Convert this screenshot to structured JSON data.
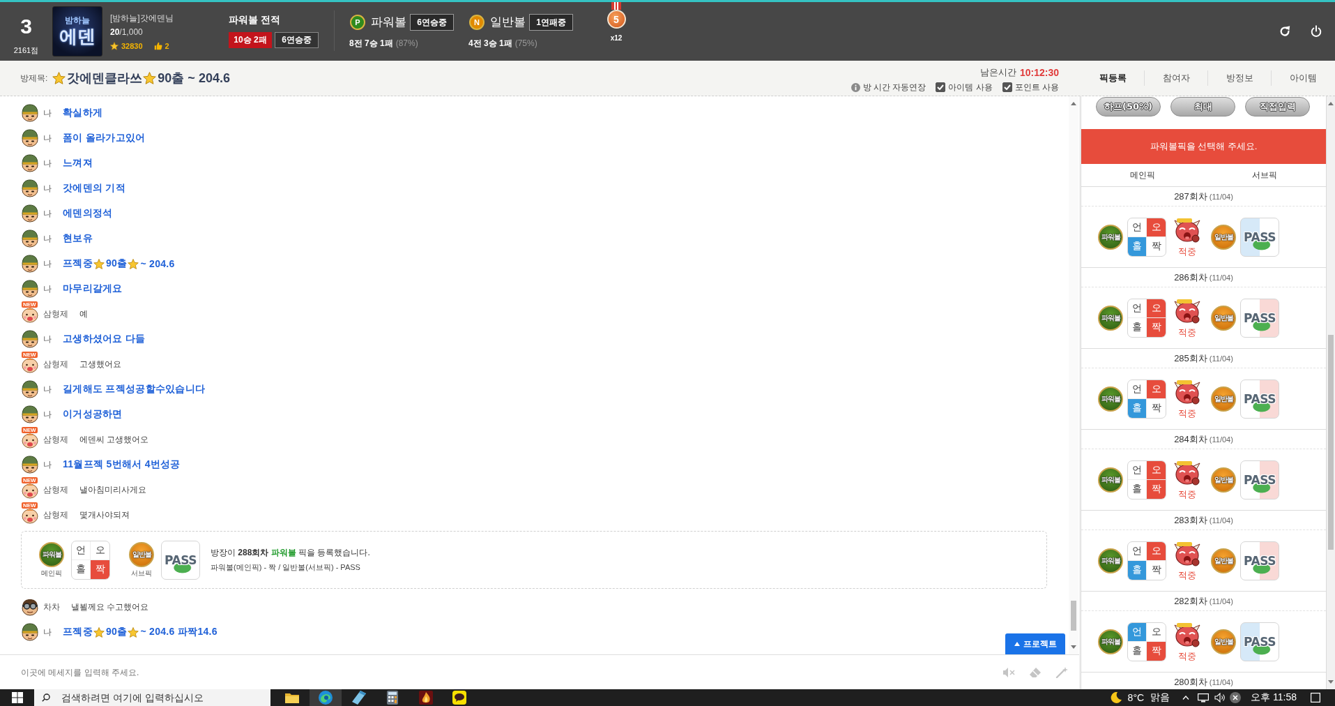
{
  "header": {
    "rank": "3",
    "score": "2161점",
    "profile_logo": {
      "top": "밤하늘",
      "main": "에덴"
    },
    "nickname": "[밤하늘]갓에덴님",
    "level": "**20**/1,000",
    "points": "32830",
    "likes": "2",
    "record": {
      "title": "파워볼 전적",
      "result": "10승 2패",
      "streak": "6연승중"
    },
    "games": [
      {
        "kind": "power",
        "badge": "P",
        "name": "파워볼",
        "streak": "6연승중",
        "record": "8전 7승 1패",
        "rate": "(87%)"
      },
      {
        "kind": "normal",
        "badge": "N",
        "name": "일반볼",
        "streak": "1연패중",
        "record": "4전 3승 1패",
        "rate": "(75%)"
      }
    ],
    "medal": {
      "number": "5",
      "count": "x12"
    }
  },
  "room": {
    "label": "방제목:",
    "title": [
      {
        "kind": "star"
      },
      {
        "kind": "text",
        "text": "갓에덴클라쓰"
      },
      {
        "kind": "star"
      },
      {
        "kind": "text",
        "text": "90출 ~ 204.6"
      }
    ],
    "time_label": "남은시간",
    "time": "10:12:30",
    "options": [
      {
        "kind": "info",
        "label": "방 시간 자동연장"
      },
      {
        "kind": "checkbox",
        "label": "아이템 사용",
        "checked": true
      },
      {
        "kind": "checkbox",
        "label": "포인트 사용",
        "checked": true
      }
    ]
  },
  "tabs": [
    {
      "label": "픽등록",
      "selected": true
    },
    {
      "label": "참여자",
      "selected": false
    },
    {
      "label": "방정보",
      "selected": false
    },
    {
      "label": "아이템",
      "selected": false
    }
  ],
  "chat": {
    "messages": [
      {
        "kind": "mine",
        "avatar": {
          "kind": "soldier"
        },
        "name": "나",
        "text": "확실하게"
      },
      {
        "kind": "mine",
        "avatar": {
          "kind": "soldier"
        },
        "name": "나",
        "text": "폼이 올라가고있어"
      },
      {
        "kind": "mine",
        "avatar": {
          "kind": "soldier"
        },
        "name": "나",
        "text": "느껴져"
      },
      {
        "kind": "mine",
        "avatar": {
          "kind": "soldier"
        },
        "name": "나",
        "text": "갓에덴의 기적"
      },
      {
        "kind": "mine",
        "avatar": {
          "kind": "soldier"
        },
        "name": "나",
        "text": "에덴의정석"
      },
      {
        "kind": "mine",
        "avatar": {
          "kind": "soldier"
        },
        "name": "나",
        "text": "현보유"
      },
      {
        "kind": "mine",
        "avatar": {
          "kind": "soldier"
        },
        "name": "나",
        "parts": [
          {
            "kind": "text",
            "text": "프젝중"
          },
          {
            "kind": "star"
          },
          {
            "kind": "text",
            "text": "90출"
          },
          {
            "kind": "star"
          },
          {
            "kind": "text",
            "text": "~ 204.6"
          }
        ]
      },
      {
        "kind": "mine",
        "avatar": {
          "kind": "soldier"
        },
        "name": "나",
        "text": "마무리갈게요"
      },
      {
        "kind": "other",
        "avatar": {
          "kind": "baby"
        },
        "badge": "NEW",
        "name": "삼형제",
        "text": "예"
      },
      {
        "kind": "mine",
        "avatar": {
          "kind": "soldier"
        },
        "name": "나",
        "text": "고생하셨어요 다들"
      },
      {
        "kind": "other",
        "avatar": {
          "kind": "baby"
        },
        "badge": "NEW",
        "name": "삼형제",
        "text": "고생했어요"
      },
      {
        "kind": "mine",
        "avatar": {
          "kind": "soldier"
        },
        "name": "나",
        "text": "길게해도 프젝성공할수있습니다"
      },
      {
        "kind": "mine",
        "avatar": {
          "kind": "soldier"
        },
        "name": "나",
        "text": "이거성공하면"
      },
      {
        "kind": "other",
        "avatar": {
          "kind": "baby"
        },
        "badge": "NEW",
        "name": "삼형제",
        "text": "에덴씨 고생했어오"
      },
      {
        "kind": "mine",
        "avatar": {
          "kind": "soldier"
        },
        "name": "나",
        "text": "11월프젝 5번해서 4번성공"
      },
      {
        "kind": "other",
        "avatar": {
          "kind": "baby"
        },
        "badge": "NEW",
        "name": "삼형제",
        "text": "낼아침미리사게요"
      },
      {
        "kind": "other",
        "avatar": {
          "kind": "baby"
        },
        "badge": "NEW",
        "name": "삼형제",
        "text": "몇개사야되져"
      },
      {
        "kind": "pick",
        "main": {
          "ball": "파워볼",
          "caption": "메인픽",
          "cells": [
            {
              "label": "언",
              "selected": false
            },
            {
              "label": "오",
              "selected": false
            },
            {
              "label": "홀",
              "selected": false
            },
            {
              "label": "짝",
              "selected": true
            }
          ]
        },
        "sub": {
          "ball": "일반볼",
          "caption": "서브픽",
          "stamp": "PASS",
          "shade_left": false,
          "shade_right": false
        },
        "message": [
          {
            "kind": "text",
            "text": "방장이"
          },
          {
            "kind": "round",
            "text": "288회차"
          },
          {
            "kind": "ball_type",
            "text": "파워볼"
          },
          {
            "kind": "text",
            "text": "픽을 등록했습니다."
          }
        ],
        "detail": "파워볼(메인픽) - 짝 / 일반볼(서브픽) - PASS"
      },
      {
        "kind": "other",
        "avatar": {
          "kind": "goggles"
        },
        "name": "차차",
        "text": "낼뵐께요 수고했어요"
      },
      {
        "kind": "mine",
        "avatar": {
          "kind": "soldier"
        },
        "name": "나",
        "parts": [
          {
            "kind": "text",
            "text": "프젝중"
          },
          {
            "kind": "star"
          },
          {
            "kind": "text",
            "text": "90출"
          },
          {
            "kind": "star"
          },
          {
            "kind": "text",
            "text": "~ 204.6 파짝14.6"
          }
        ]
      }
    ],
    "project_button": "프로젝트",
    "input": {
      "placeholder": "이곳에 메세지를 입력해 주세요."
    }
  },
  "pick_panel": {
    "bet_buttons": [
      "하프(50%)",
      "최대",
      "직접입력"
    ],
    "notice": "파워볼픽을 선택해 주세요.",
    "columns": [
      "메인픽",
      "서브픽"
    ],
    "rounds": [
      {
        "round": "287회차",
        "date": "(11/04)",
        "main": {
          "ball": "파워볼",
          "cells": [
            {
              "label": "언",
              "selected": false
            },
            {
              "label": "오",
              "selected": true
            },
            {
              "label": "홀",
              "selected": true
            },
            {
              "label": "짝",
              "selected": false
            }
          ]
        },
        "result": "적중",
        "sub": {
          "ball": "일반볼",
          "stamp": "PASS",
          "shade_left": true,
          "shade_right": false
        }
      },
      {
        "round": "286회차",
        "date": "(11/04)",
        "main": {
          "ball": "파워볼",
          "cells": [
            {
              "label": "언",
              "selected": false
            },
            {
              "label": "오",
              "selected": true
            },
            {
              "label": "홀",
              "selected": false
            },
            {
              "label": "짝",
              "selected": true
            }
          ]
        },
        "result": "적중",
        "sub": {
          "ball": "일반볼",
          "stamp": "PASS",
          "shade_left": false,
          "shade_right": true
        }
      },
      {
        "round": "285회차",
        "date": "(11/04)",
        "main": {
          "ball": "파워볼",
          "cells": [
            {
              "label": "언",
              "selected": false
            },
            {
              "label": "오",
              "selected": true
            },
            {
              "label": "홀",
              "selected": true
            },
            {
              "label": "짝",
              "selected": false
            }
          ]
        },
        "result": "적중",
        "sub": {
          "ball": "일반볼",
          "stamp": "PASS",
          "shade_left": false,
          "shade_right": true
        }
      },
      {
        "round": "284회차",
        "date": "(11/04)",
        "main": {
          "ball": "파워볼",
          "cells": [
            {
              "label": "언",
              "selected": false
            },
            {
              "label": "오",
              "selected": true
            },
            {
              "label": "홀",
              "selected": false
            },
            {
              "label": "짝",
              "selected": true
            }
          ]
        },
        "result": "적중",
        "sub": {
          "ball": "일반볼",
          "stamp": "PASS",
          "shade_left": false,
          "shade_right": true
        }
      },
      {
        "round": "283회차",
        "date": "(11/04)",
        "main": {
          "ball": "파워볼",
          "cells": [
            {
              "label": "언",
              "selected": false
            },
            {
              "label": "오",
              "selected": true
            },
            {
              "label": "홀",
              "selected": true
            },
            {
              "label": "짝",
              "selected": false
            }
          ]
        },
        "result": "적중",
        "sub": {
          "ball": "일반볼",
          "stamp": "PASS",
          "shade_left": false,
          "shade_right": true
        }
      },
      {
        "round": "282회차",
        "date": "(11/04)",
        "main": {
          "ball": "파워볼",
          "cells": [
            {
              "label": "언",
              "selected": true
            },
            {
              "label": "오",
              "selected": false
            },
            {
              "label": "홀",
              "selected": false
            },
            {
              "label": "짝",
              "selected": true
            }
          ]
        },
        "result": "적중",
        "sub": {
          "ball": "일반볼",
          "stamp": "PASS",
          "shade_left": true,
          "shade_right": false
        }
      },
      {
        "round": "280회차",
        "date": "(11/04)"
      }
    ]
  },
  "taskbar": {
    "search": {
      "placeholder": "검색하려면 여기에 입력하십시오"
    },
    "apps": [
      {
        "kind": "folder",
        "active": false
      },
      {
        "kind": "browser",
        "active": true
      },
      {
        "kind": "pen",
        "active": false
      },
      {
        "kind": "calculator",
        "active": false
      },
      {
        "kind": "flame",
        "active": false
      },
      {
        "kind": "chat",
        "active": false
      }
    ],
    "weather": {
      "temp": "8°C",
      "condition": "맑음"
    },
    "clock": "오후 11:58"
  }
}
